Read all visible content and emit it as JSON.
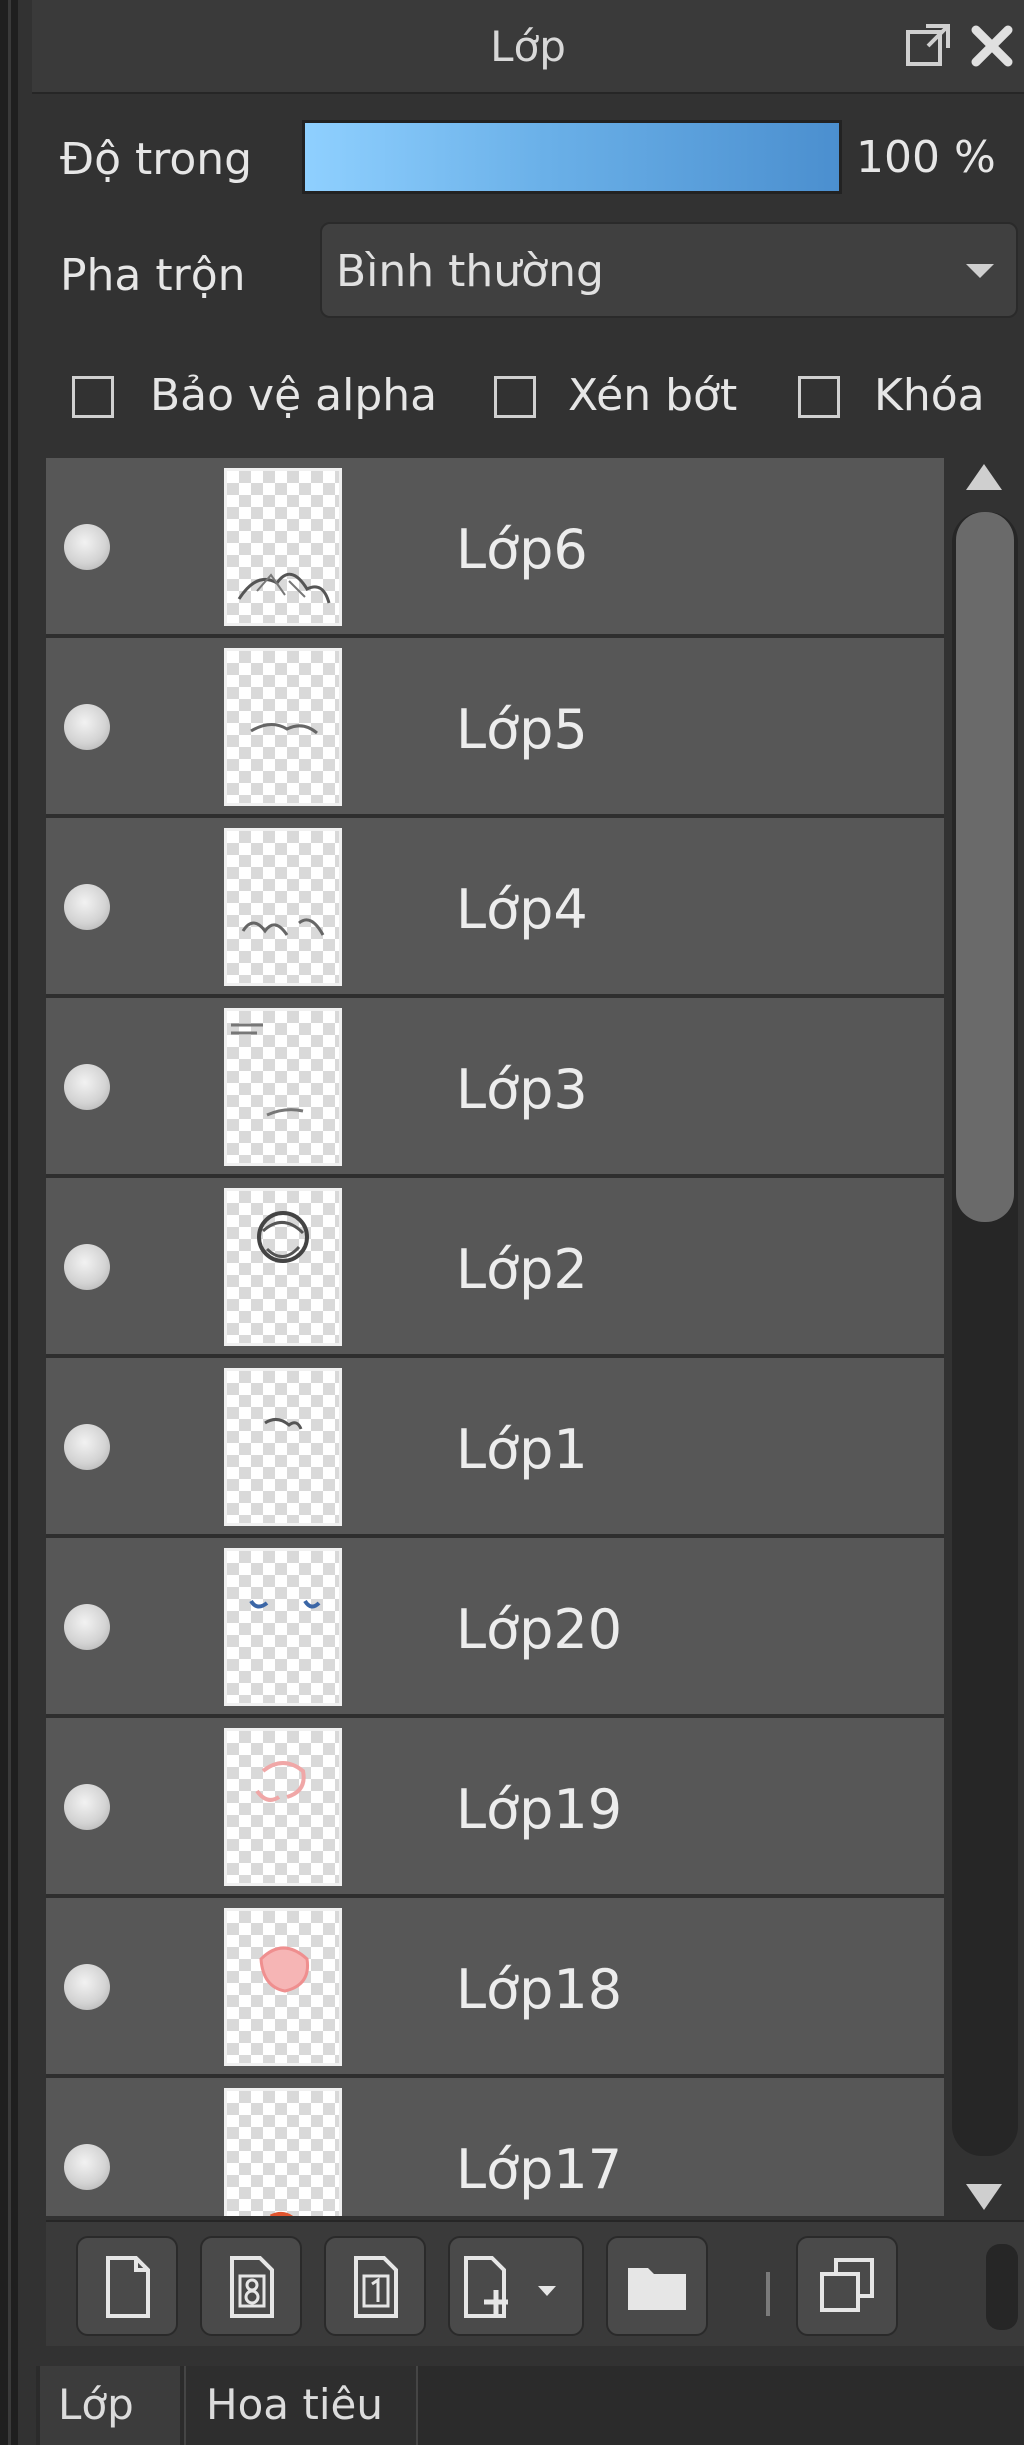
{
  "panel": {
    "title": "Lớp",
    "float_icon": "popout-icon",
    "close_icon": "close-icon"
  },
  "opacity": {
    "label": "Độ trong",
    "value_text": "100 %",
    "value": 100,
    "bar_color_start": "#8fd0ff",
    "bar_color_end": "#4b8fcf"
  },
  "blend": {
    "label": "Pha trộn",
    "selected": "Bình thường"
  },
  "checkboxes": [
    {
      "label": "Bảo vệ alpha",
      "checked": false
    },
    {
      "label": "Xén bớt",
      "checked": false
    },
    {
      "label": "Khóa",
      "checked": false
    }
  ],
  "layers": [
    {
      "name": "Lớp6",
      "visible": true
    },
    {
      "name": "Lớp5",
      "visible": true
    },
    {
      "name": "Lớp4",
      "visible": true
    },
    {
      "name": "Lớp3",
      "visible": true
    },
    {
      "name": "Lớp2",
      "visible": true
    },
    {
      "name": "Lớp1",
      "visible": true
    },
    {
      "name": "Lớp20",
      "visible": true
    },
    {
      "name": "Lớp19",
      "visible": true
    },
    {
      "name": "Lớp18",
      "visible": true
    },
    {
      "name": "Lớp17",
      "visible": true
    }
  ],
  "toolbar": {
    "buttons": [
      "new-layer-icon",
      "new-8bit-layer-icon",
      "new-1bit-layer-icon",
      "add-layer-menu-icon",
      "folder-icon",
      "duplicate-layer-icon"
    ]
  },
  "tabs": [
    {
      "label": "Lớp",
      "active": true
    },
    {
      "label": "Hoa tiêu",
      "active": false
    }
  ]
}
